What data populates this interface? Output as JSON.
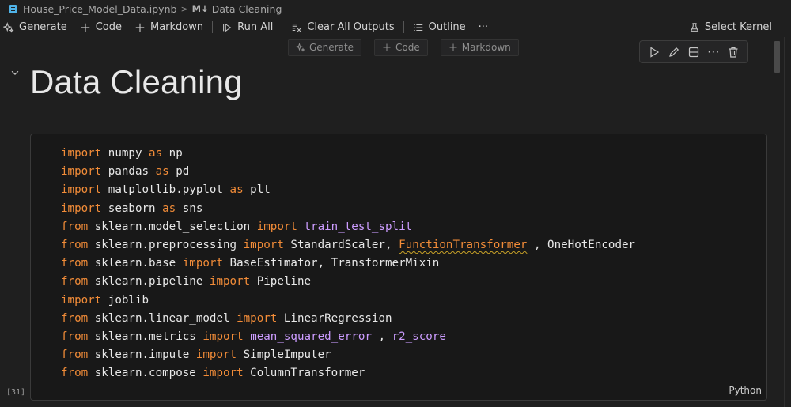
{
  "breadcrumb": {
    "file_name": "House_Price_Model_Data.ipynb",
    "separator": ">",
    "md_glyph": "M↓",
    "section": "Data Cleaning"
  },
  "toolbar": {
    "generate": "Generate",
    "code": "Code",
    "markdown": "Markdown",
    "run_all": "Run All",
    "clear_outputs": "Clear All Outputs",
    "outline": "Outline",
    "more": "···",
    "select_kernel": "Select Kernel"
  },
  "insert_bar": {
    "generate": "Generate",
    "code": "Code",
    "markdown": "Markdown"
  },
  "cell_toolbar": {
    "more": "···"
  },
  "markdown_cell": {
    "heading": "Data Cleaning"
  },
  "code_cell": {
    "execution_count": "[31]",
    "language": "Python",
    "lines": [
      [
        {
          "t": "import",
          "c": "kw"
        },
        {
          "t": " numpy ",
          "c": "mod"
        },
        {
          "t": "as",
          "c": "kw"
        },
        {
          "t": " np",
          "c": "mod"
        }
      ],
      [
        {
          "t": "import",
          "c": "kw"
        },
        {
          "t": " pandas ",
          "c": "mod"
        },
        {
          "t": "as",
          "c": "kw"
        },
        {
          "t": " pd",
          "c": "mod"
        }
      ],
      [
        {
          "t": "import",
          "c": "kw"
        },
        {
          "t": " matplotlib.pyplot ",
          "c": "mod"
        },
        {
          "t": "as",
          "c": "kw"
        },
        {
          "t": " plt",
          "c": "mod"
        }
      ],
      [
        {
          "t": "import",
          "c": "kw"
        },
        {
          "t": " seaborn ",
          "c": "mod"
        },
        {
          "t": "as",
          "c": "kw"
        },
        {
          "t": " sns",
          "c": "mod"
        }
      ],
      [
        {
          "t": "from",
          "c": "kw"
        },
        {
          "t": " sklearn.model_selection ",
          "c": "mod"
        },
        {
          "t": "import",
          "c": "kw"
        },
        {
          "t": " ",
          "c": "mod"
        },
        {
          "t": "train_test_split",
          "c": "fn"
        }
      ],
      [
        {
          "t": "from",
          "c": "kw"
        },
        {
          "t": " sklearn.preprocessing ",
          "c": "mod"
        },
        {
          "t": "import",
          "c": "kw"
        },
        {
          "t": " StandardScaler, ",
          "c": "mod"
        },
        {
          "t": "FunctionTransformer",
          "c": "kw squig"
        },
        {
          "t": " , OneHotEncoder",
          "c": "mod"
        }
      ],
      [
        {
          "t": "from",
          "c": "kw"
        },
        {
          "t": " sklearn.base ",
          "c": "mod"
        },
        {
          "t": "import",
          "c": "kw"
        },
        {
          "t": " BaseEstimator, TransformerMixin",
          "c": "mod"
        }
      ],
      [
        {
          "t": "from",
          "c": "kw"
        },
        {
          "t": " sklearn.pipeline ",
          "c": "mod"
        },
        {
          "t": "import",
          "c": "kw"
        },
        {
          "t": " Pipeline",
          "c": "mod"
        }
      ],
      [
        {
          "t": "import",
          "c": "kw"
        },
        {
          "t": " joblib",
          "c": "mod"
        }
      ],
      [
        {
          "t": "from",
          "c": "kw"
        },
        {
          "t": " sklearn.linear_model ",
          "c": "mod"
        },
        {
          "t": "import",
          "c": "kw"
        },
        {
          "t": " LinearRegression",
          "c": "mod"
        }
      ],
      [
        {
          "t": "from",
          "c": "kw"
        },
        {
          "t": " sklearn.metrics ",
          "c": "mod"
        },
        {
          "t": "import",
          "c": "kw"
        },
        {
          "t": " ",
          "c": "mod"
        },
        {
          "t": "mean_squared_error",
          "c": "fn"
        },
        {
          "t": " , ",
          "c": "mod"
        },
        {
          "t": "r2_score",
          "c": "fn"
        }
      ],
      [
        {
          "t": "from",
          "c": "kw"
        },
        {
          "t": " sklearn.impute ",
          "c": "mod"
        },
        {
          "t": "import",
          "c": "kw"
        },
        {
          "t": " SimpleImputer",
          "c": "mod"
        }
      ],
      [
        {
          "t": "from",
          "c": "kw"
        },
        {
          "t": " sklearn.compose ",
          "c": "mod"
        },
        {
          "t": "import",
          "c": "kw"
        },
        {
          "t": " ColumnTransformer",
          "c": "mod"
        }
      ]
    ]
  }
}
